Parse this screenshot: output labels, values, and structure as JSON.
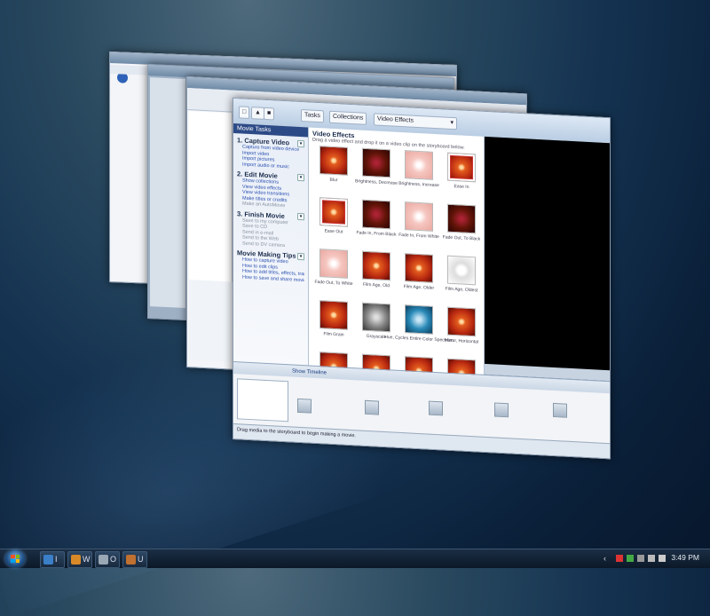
{
  "theme": {
    "accent": "#2c4a86",
    "desktop": "#143250",
    "taskbar": "#0b1828"
  },
  "movie_maker": {
    "toolbar": {
      "tasks_label": "Tasks",
      "collections_label": "Collections",
      "collection_name": "Video Effects"
    },
    "tasks_header": "Movie Tasks",
    "sections": [
      {
        "title": "1. Capture Video",
        "links": [
          "Capture from video device",
          "Import video",
          "Import pictures",
          "Import audio or music"
        ],
        "disabled": [
          false,
          false,
          false,
          false
        ]
      },
      {
        "title": "2. Edit Movie",
        "links": [
          "Show collections",
          "View video effects",
          "View video transitions",
          "Make titles or credits",
          "Make an AutoMovie"
        ],
        "disabled": [
          false,
          false,
          false,
          false,
          true
        ]
      },
      {
        "title": "3. Finish Movie",
        "links": [
          "Save to my computer",
          "Save to CD",
          "Send in e-mail",
          "Send to the Web",
          "Send to DV camera"
        ],
        "disabled": [
          true,
          true,
          true,
          true,
          true
        ]
      },
      {
        "title": "Movie Making Tips",
        "links": [
          "How to capture video",
          "How to edit clips",
          "How to add titles, effects, transitions",
          "How to save and share movies"
        ],
        "disabled": [
          false,
          false,
          false,
          false
        ]
      }
    ],
    "effects_title": "Video Effects",
    "effects_subtitle": "Drag a video effect and drop it on a video clip on the storyboard below.",
    "effects": [
      {
        "name": "Blur",
        "style": "normal"
      },
      {
        "name": "Brightness, Decrease",
        "style": "dark"
      },
      {
        "name": "Brightness, Increase",
        "style": "pale"
      },
      {
        "name": "Ease In",
        "style": "frame"
      },
      {
        "name": "Ease Out",
        "style": "frame"
      },
      {
        "name": "Fade In, From Black",
        "style": "dark"
      },
      {
        "name": "Fade In, From White",
        "style": "pale"
      },
      {
        "name": "Fade Out, To Black",
        "style": "dark"
      },
      {
        "name": "Fade Out, To White",
        "style": "pale"
      },
      {
        "name": "Film Age, Old",
        "style": "normal"
      },
      {
        "name": "Film Age, Older",
        "style": "normal"
      },
      {
        "name": "Film Age, Oldest",
        "style": "sketch"
      },
      {
        "name": "Film Grain",
        "style": "normal"
      },
      {
        "name": "Grayscale",
        "style": "gray"
      },
      {
        "name": "Hue, Cycles Entire Color Spectrum",
        "style": "blue"
      },
      {
        "name": "Mirror, Horizontal",
        "style": "normal"
      },
      {
        "name": "",
        "style": "normal"
      },
      {
        "name": "",
        "style": "normal"
      },
      {
        "name": "",
        "style": "normal"
      },
      {
        "name": "",
        "style": "normal"
      }
    ],
    "timeline_label": "Show Timeline",
    "status_text": "Drag media to the storyboard to begin making a movie."
  },
  "taskbar": {
    "buttons": [
      {
        "label": "I",
        "icon": "ie-icon",
        "color": "#3a7fc8"
      },
      {
        "label": "W",
        "icon": "movie-maker-icon",
        "color": "#d88a28"
      },
      {
        "label": "O",
        "icon": "explorer-icon",
        "color": "#9aa7b5"
      },
      {
        "label": "U",
        "icon": "window-icon",
        "color": "#c07030"
      }
    ],
    "clock": "3:49 PM"
  }
}
